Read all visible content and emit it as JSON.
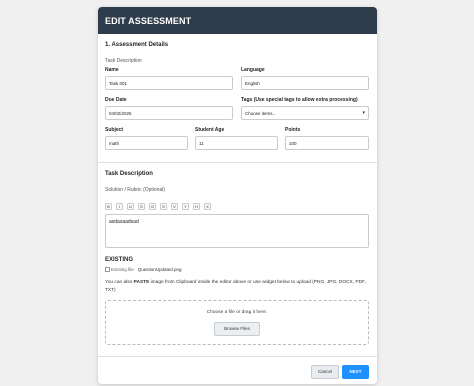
{
  "header": {
    "title": "EDIT ASSESSMENT"
  },
  "details": {
    "section_title": "1. Assessment Details",
    "task_description_label": "Task Description",
    "name_label": "Name",
    "name_value": "Task 001",
    "language_label": "Language",
    "language_value": "English",
    "due_date_label": "Due Date",
    "due_date_value": "04/02/2025",
    "tags_label": "Tags (Use special tags to allow extra processing)",
    "tags_placeholder": "Choose items...",
    "subject_label": "Subject",
    "subject_value": "math",
    "student_age_label": "Student Age",
    "student_age_value": "11",
    "points_label": "Points",
    "points_value": "100"
  },
  "task": {
    "section_title": "Task Description",
    "rubric_label": "Solution / Rubric (Optional)",
    "toolbar": [
      "B",
      "I",
      "U",
      "S",
      "G",
      "S",
      "V",
      "Y",
      "H",
      "X"
    ],
    "editor_text": "asdasaadsad"
  },
  "existing": {
    "title": "EXISTING",
    "image_alt": "Existing file",
    "file_name": "QuestionUpdated.png",
    "paste_prefix": "You can also ",
    "paste_bold": "PASTE",
    "paste_suffix": " image from Clipboard inside the editor above or use widget below to upload (PNG, JPG, DOCX, PDF, TXT)",
    "dropzone_text": "Choose a file or drag it here.",
    "browse_label": "Browse Files"
  },
  "footer": {
    "cancel_label": "Cancel",
    "next_label": "NEXT"
  },
  "colors": {
    "header_bg": "#2f3c4b",
    "accent": "#1e90ff"
  }
}
